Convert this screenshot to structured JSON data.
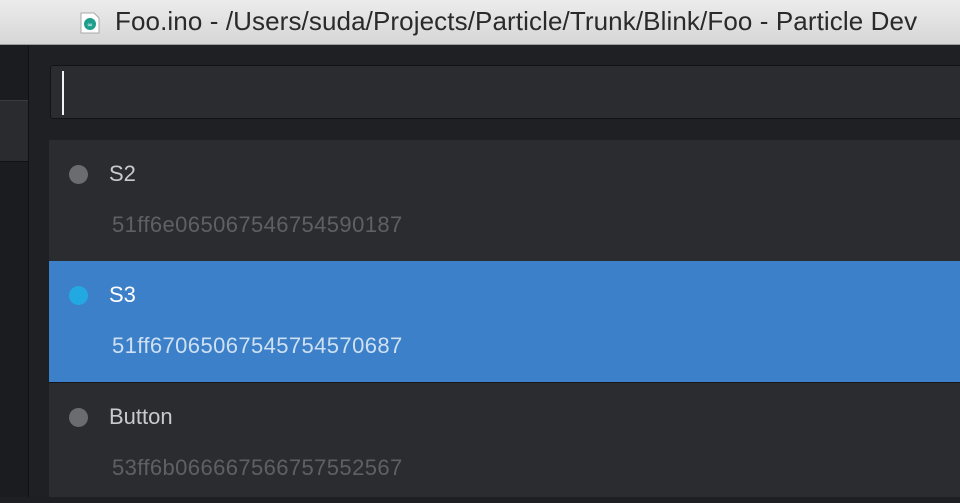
{
  "window": {
    "title": "Foo.ino - /Users/suda/Projects/Particle/Trunk/Blink/Foo - Particle Dev",
    "file_icon": "arduino-file-icon"
  },
  "search": {
    "value": "",
    "placeholder": ""
  },
  "devices": [
    {
      "name": "S2",
      "id": "51ff6e065067546754590187",
      "selected": false,
      "status_color": "#6b6c70"
    },
    {
      "name": "S3",
      "id": "51ff67065067545754570687",
      "selected": true,
      "status_color": "#23a9e1"
    },
    {
      "name": "Button",
      "id": "53ff6b066667566757552567",
      "selected": false,
      "status_color": "#6b6c70"
    }
  ],
  "colors": {
    "selection": "#3b80c8",
    "online_dot": "#23a9e1",
    "offline_dot": "#6b6c70"
  }
}
